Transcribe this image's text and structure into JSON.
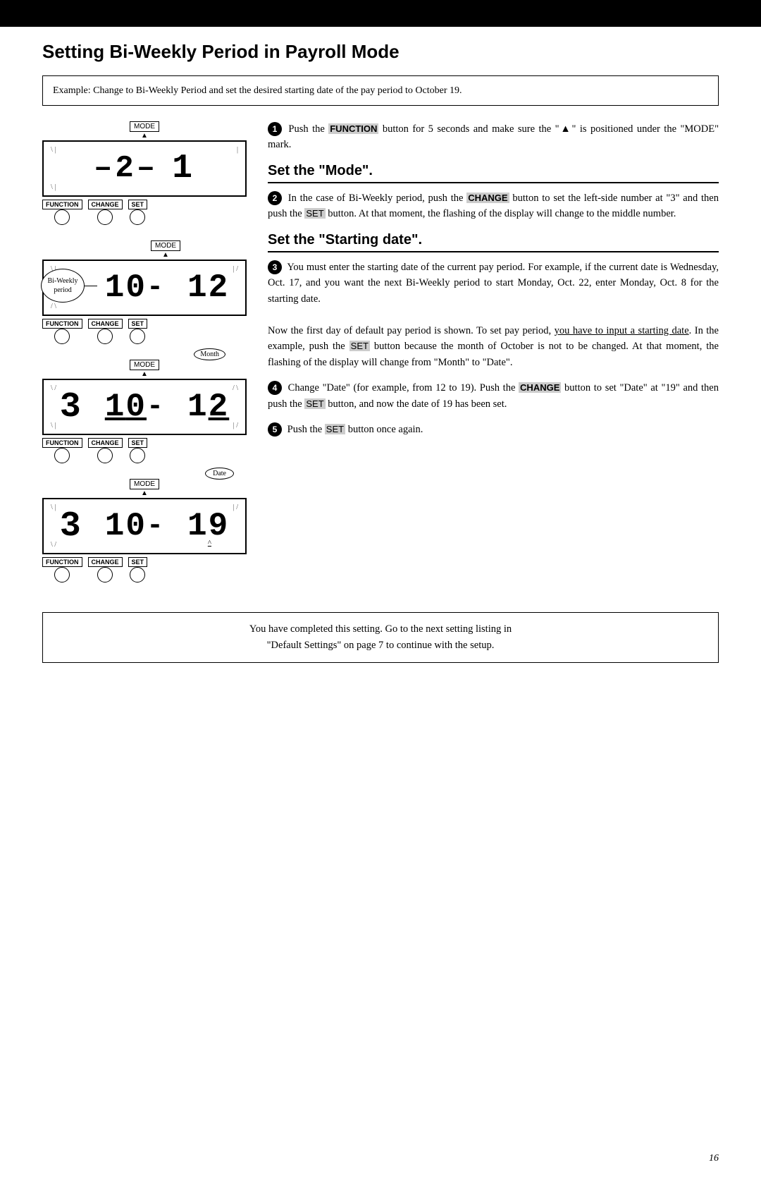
{
  "topBar": {},
  "pageTitle": "Setting Bi-Weekly Period in Payroll Mode",
  "exampleBox": {
    "text": "Example: Change to Bi-Weekly Period and set the desired starting date of the pay period to October 19."
  },
  "diagrams": [
    {
      "id": "diagram1",
      "modeLabel": "MODE",
      "hasArrow": true,
      "display": "2 - 1",
      "digits": [
        "2",
        "-",
        "1"
      ],
      "buttons": [
        "FUNCTION",
        "CHANGE",
        "SET"
      ],
      "callout": null
    },
    {
      "id": "diagram2",
      "modeLabel": "MODE",
      "hasArrow": true,
      "display": "3 10- 12",
      "callout": "Bi-Weekly\nperiod",
      "buttons": [
        "FUNCTION",
        "CHANGE",
        "SET"
      ]
    },
    {
      "id": "diagram3",
      "modeLabel": "MODE",
      "hasArrow": true,
      "display": "3 10- 12",
      "callout": "Month",
      "buttons": [
        "FUNCTION",
        "CHANGE",
        "SET"
      ]
    },
    {
      "id": "diagram4",
      "modeLabel": "MODE",
      "hasArrow": true,
      "display": "3 10- 19",
      "callout": "Date",
      "buttons": [
        "FUNCTION",
        "CHANGE",
        "SET"
      ]
    }
  ],
  "sections": {
    "setMode": {
      "heading": "Set the \"Mode\".",
      "steps": [
        {
          "num": "1",
          "text": "Push the FUNCTION button for 5 seconds and make sure the \"▲\" is positioned under the \"MODE\" mark."
        },
        {
          "num": "2",
          "text": "In the case of Bi-Weekly period, push the CHANGE button to set the left-side number at \"3\" and then push the SET button. At that moment, the flashing of the display will change to the middle number."
        }
      ]
    },
    "setStartingDate": {
      "heading": "Set the \"Starting date\".",
      "steps": [
        {
          "num": "3",
          "text": "You must enter the starting date of the current pay period. For example, if the current date is Wednesday, Oct. 17, and you want the next Bi-Weekly period to start Monday, Oct. 22, enter Monday, Oct. 8 for the starting date.\nNow the first day of default pay period is shown. To set pay period, you have to input a starting date. In the example, push the SET button because the month of October is not to be changed. At that moment, the flashing of the display will change from \"Month\" to \"Date\"."
        },
        {
          "num": "4",
          "text": "Change \"Date\" (for example, from 12 to 19). Push the CHANGE button to set \"Date\" at \"19\" and then push the SET button, and now the date of 19 has been set."
        },
        {
          "num": "5",
          "text": "Push the SET button once again."
        }
      ]
    }
  },
  "bottomBox": {
    "line1": "You have completed this setting.  Go to the next setting listing in",
    "line2": "\"Default Settings\" on page 7 to continue with the setup."
  },
  "pageNumber": "16"
}
